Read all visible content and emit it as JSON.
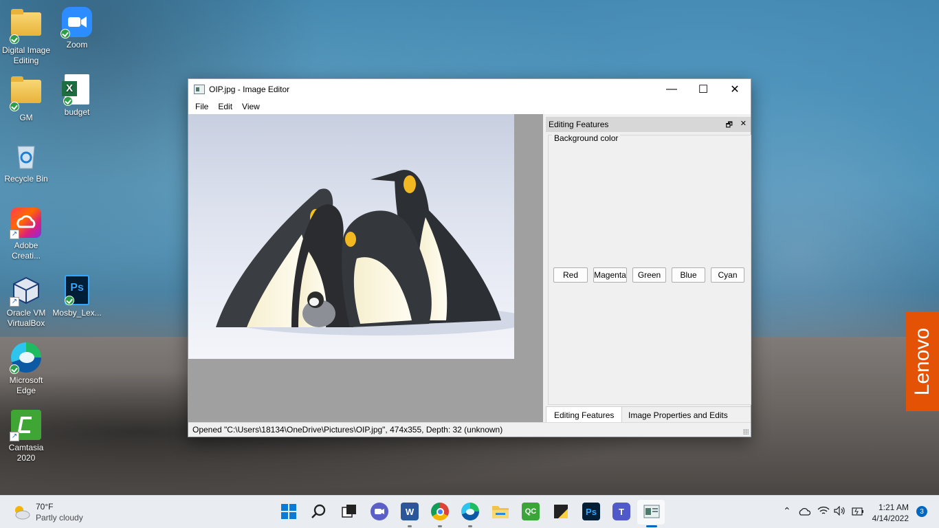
{
  "desktop": {
    "icons": [
      {
        "label": "Digital Image Editing",
        "icon": "folder-icon"
      },
      {
        "label": "Zoom",
        "icon": "zoom-icon"
      },
      {
        "label": "GM",
        "icon": "folder-icon"
      },
      {
        "label": "budget",
        "icon": "excel-file-icon"
      },
      {
        "label": "Recycle Bin",
        "icon": "recycle-bin-icon"
      },
      {
        "label": "Adobe Creati...",
        "icon": "adobe-creative-cloud-icon"
      },
      {
        "label": "Oracle VM VirtualBox",
        "icon": "virtualbox-icon"
      },
      {
        "label": "Mosby_Lex...",
        "icon": "psd-file-icon"
      },
      {
        "label": "Microsoft Edge",
        "icon": "edge-icon"
      },
      {
        "label": "Camtasia 2020",
        "icon": "camtasia-icon"
      }
    ],
    "watermark": "Lenovo"
  },
  "window": {
    "title": "OIP.jpg - Image Editor",
    "controls": {
      "minimize": "—",
      "maximize": "☐",
      "close": "✕"
    },
    "menu": [
      "File",
      "Edit",
      "View"
    ],
    "dock": {
      "title": "Editing Features",
      "float_glyph": "🗗",
      "close_glyph": "✕",
      "group_title": "Background color",
      "buttons": [
        "Red",
        "Magenta",
        "Green",
        "Blue",
        "Cyan"
      ],
      "tabs": [
        "Editing Features",
        "Image Properties and Edits"
      ],
      "active_tab": "Editing Features"
    },
    "status": "Opened \"C:\\Users\\18134\\OneDrive\\Pictures\\OIP.jpg\", 474x355, Depth: 32 (unknown)"
  },
  "taskbar": {
    "weather": {
      "temp": "70°F",
      "desc": "Partly cloudy"
    },
    "apps": [
      "start-icon",
      "search-icon",
      "task-view-icon",
      "chat-icon",
      "word-icon",
      "chrome-icon",
      "edge-icon",
      "file-explorer-icon",
      "qc-icon",
      "sticky-notes-icon",
      "photoshop-icon",
      "teams-icon",
      "image-editor-icon"
    ],
    "app_text": {
      "word": "W",
      "qc": "QC",
      "ps": "Ps",
      "teams": "T"
    },
    "clock": {
      "time": "1:21 AM",
      "date": "4/14/2022"
    },
    "notifications": "3"
  }
}
